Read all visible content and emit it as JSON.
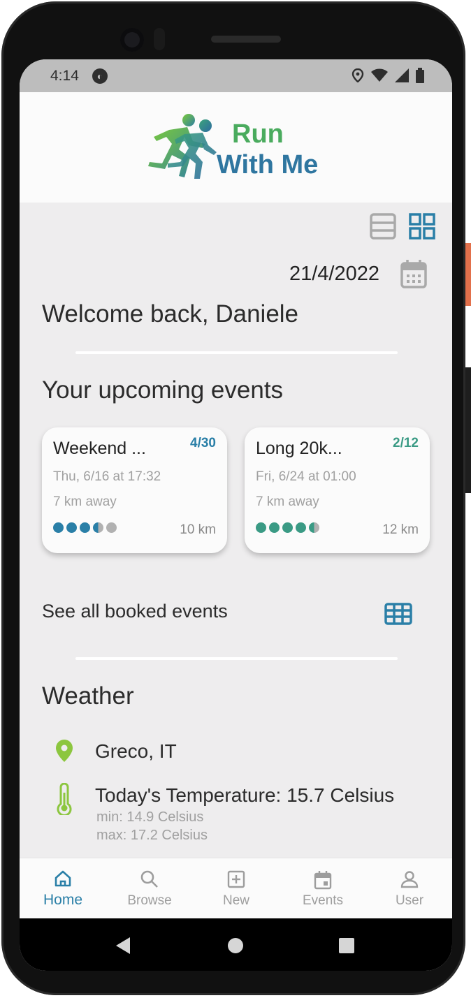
{
  "status_bar": {
    "time": "4:14",
    "badge": ""
  },
  "logo": {
    "line1": "Run",
    "line2": "With Me"
  },
  "date": "21/4/2022",
  "welcome": "Welcome back, Daniele",
  "upcoming_title": "Your upcoming events",
  "events": [
    {
      "title": "Weekend ...",
      "count": "4/30",
      "datetime": "Thu, 6/16 at 17:32",
      "distance_away": "7 km away",
      "length": "10 km",
      "color": "#2a7fa7",
      "level": 3.5
    },
    {
      "title": "Long 20k...",
      "count": "2/12",
      "datetime": "Fri, 6/24 at 01:00",
      "distance_away": "7 km away",
      "length": "12 km",
      "color": "#3a9a84",
      "level": 4.5
    }
  ],
  "see_all": "See all booked events",
  "weather": {
    "title": "Weather",
    "location": "Greco, IT",
    "temperature": "Today's Temperature: 15.7 Celsius",
    "min": "min: 14.9 Celsius",
    "max": "max: 17.2 Celsius"
  },
  "tabs": [
    {
      "label": "Home",
      "icon": "home-icon",
      "active": true
    },
    {
      "label": "Browse",
      "icon": "search-icon",
      "active": false
    },
    {
      "label": "New",
      "icon": "plus-square-icon",
      "active": false
    },
    {
      "label": "Events",
      "icon": "calendar-icon",
      "active": false
    },
    {
      "label": "User",
      "icon": "user-icon",
      "active": false
    }
  ],
  "colors": {
    "accent": "#2a7fa7",
    "teal": "#3a9a84",
    "lime": "#8cc63f",
    "grey_icon": "#a9a9a9"
  }
}
